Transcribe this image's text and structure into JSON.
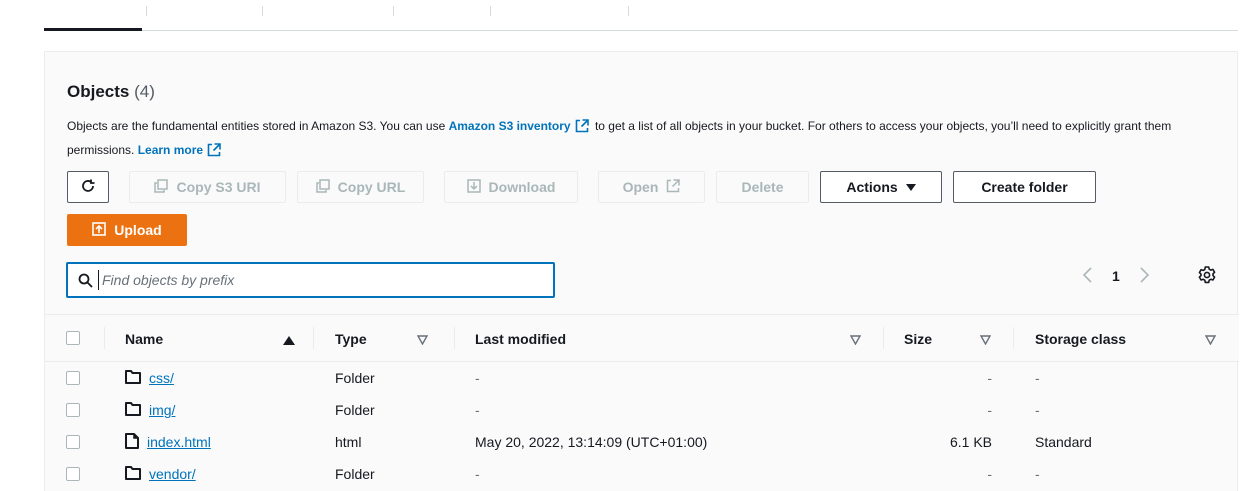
{
  "panel": {
    "title": "Objects",
    "count": "(4)",
    "desc_part1": "Objects are the fundamental entities stored in Amazon S3. You can use ",
    "desc_link1": "Amazon S3 inventory",
    "desc_part2": " to get a list of all objects in your bucket. For others to access your objects, you’ll need to explicitly grant them permissions. ",
    "desc_link2": "Learn more"
  },
  "toolbar": {
    "copy_s3_uri": "Copy S3 URI",
    "copy_url": "Copy URL",
    "download": "Download",
    "open": "Open",
    "delete": "Delete",
    "actions": "Actions",
    "create_folder": "Create folder",
    "upload": "Upload"
  },
  "search": {
    "placeholder": "Find objects by prefix",
    "value": ""
  },
  "pagination": {
    "current_page": "1"
  },
  "table": {
    "columns": {
      "name": "Name",
      "type": "Type",
      "last_modified": "Last modified",
      "size": "Size",
      "storage_class": "Storage class"
    },
    "rows": [
      {
        "name": "css/",
        "kind": "folder",
        "type": "Folder",
        "last_modified": "-",
        "size": "-",
        "storage_class": "-"
      },
      {
        "name": "img/",
        "kind": "folder",
        "type": "Folder",
        "last_modified": "-",
        "size": "-",
        "storage_class": "-"
      },
      {
        "name": "index.html",
        "kind": "file",
        "type": "html",
        "last_modified": "May 20, 2022, 13:14:09 (UTC+01:00)",
        "size": "6.1 KB",
        "storage_class": "Standard"
      },
      {
        "name": "vendor/",
        "kind": "folder",
        "type": "Folder",
        "last_modified": "-",
        "size": "-",
        "storage_class": "-"
      }
    ]
  },
  "colors": {
    "accent_link": "#0073bb",
    "primary_button": "#ec7211",
    "disabled_text": "#aab7b8"
  }
}
